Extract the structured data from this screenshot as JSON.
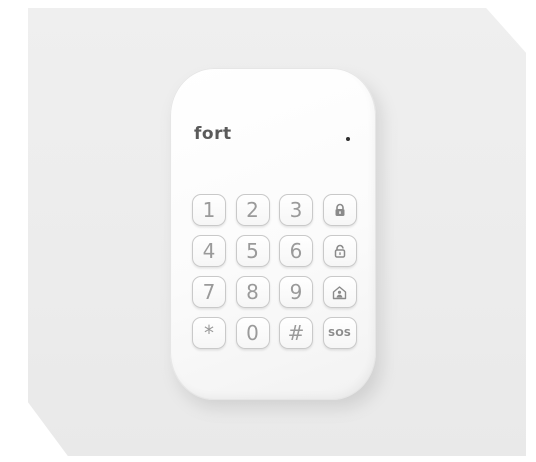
{
  "device": {
    "brand": "Fort",
    "logo_text": "fort"
  },
  "keypad": {
    "keys": [
      {
        "label": "1",
        "icon": null
      },
      {
        "label": "2",
        "icon": null
      },
      {
        "label": "3",
        "icon": null
      },
      {
        "label": "",
        "icon": "lock-closed-icon"
      },
      {
        "label": "4",
        "icon": null
      },
      {
        "label": "5",
        "icon": null
      },
      {
        "label": "6",
        "icon": null
      },
      {
        "label": "",
        "icon": "lock-open-icon"
      },
      {
        "label": "7",
        "icon": null
      },
      {
        "label": "8",
        "icon": null
      },
      {
        "label": "9",
        "icon": null
      },
      {
        "label": "",
        "icon": "home-person-icon"
      },
      {
        "label": "*",
        "icon": null
      },
      {
        "label": "0",
        "icon": null
      },
      {
        "label": "#",
        "icon": null
      },
      {
        "label": "SOS",
        "icon": null
      }
    ]
  },
  "colors": {
    "body": "#ffffff",
    "key_border": "#c9c9c9",
    "key_text": "#9a9a9a",
    "led": "#2e2e2e",
    "logo": "#5a5a5a"
  }
}
